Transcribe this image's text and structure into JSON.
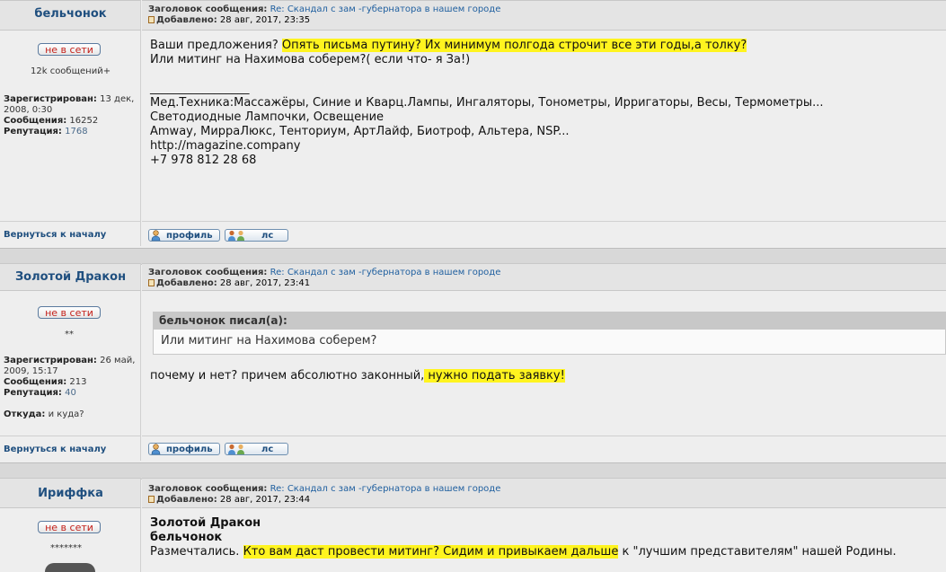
{
  "subject_label": "Заголовок сообщения:",
  "added_label": "Добавлено:",
  "back_to_top": "Вернуться к началу",
  "profile_btn": "профиль",
  "pm_btn": "лс",
  "offline": "не в сети",
  "posts": [
    {
      "author": "бельчонок",
      "subject": "Re: Скандал с зам -губернатора в нашем городе",
      "date": "28 авг, 2017, 23:35",
      "rank": "12k сообщений+",
      "reg_label": "Зарегистрирован:",
      "reg_value_1": "13 дек,",
      "reg_value_2": "2008, 0:30",
      "msgs_label": "Сообщения:",
      "msgs_value": "16252",
      "rep_label": "Репутация:",
      "rep_value": "1768",
      "body": {
        "line1_a": "Ваши предложения? ",
        "line1_hl": "Опять письма путину? Их минимум полгода строчит все эти годы,а толку?",
        "line2": "Или митинг на Нахимова соберем?( если что- я За!)",
        "sig_rule": "_________________",
        "sig1": "Мед.Техника:Массажёры, Синие и Кварц.Лампы, Ингаляторы, Тонометры, Ирригаторы, Весы, Термометры...",
        "sig2": "Светодиодные Лампочки, Освещение",
        "sig3": "Amway, МирраЛюкс, Тенториум, АртЛайф, Биотроф, Альтера, NSP...",
        "sig4": "http://magazine.company",
        "sig5": "+7 978 812 28 68"
      }
    },
    {
      "author": "Золотой Дракон",
      "subject": "Re: Скандал с зам -губернатора в нашем городе",
      "date": "28 авг, 2017, 23:41",
      "rank": "**",
      "reg_label": "Зарегистрирован:",
      "reg_value_1": "26 май,",
      "reg_value_2": "2009, 15:17",
      "msgs_label": "Сообщения:",
      "msgs_value": "213",
      "rep_label": "Репутация:",
      "rep_value": "40",
      "from_label": "Откуда:",
      "from_value": "и куда?",
      "quote_author": "бельчонок писал(а):",
      "quote_text": "Или митинг на Нахимова соберем?",
      "body": {
        "line_a": "почему и нет? причем абсолютно законный,",
        "line_hl": " нужно подать заявку!"
      }
    },
    {
      "author": "Ириффка",
      "subject": "Re: Скандал с зам -губернатора в нашем городе",
      "date": "28 авг, 2017, 23:44",
      "rank": "*******",
      "body": {
        "name1": "Золотой Дракон",
        "name2": "бельчонок",
        "line_a": "Размечтались. ",
        "line_hl": "Кто вам даст провести митинг? Сидим и привыкаем дальше",
        "line_b": " к \"лучшим представителям\" нашей Родины."
      }
    }
  ]
}
